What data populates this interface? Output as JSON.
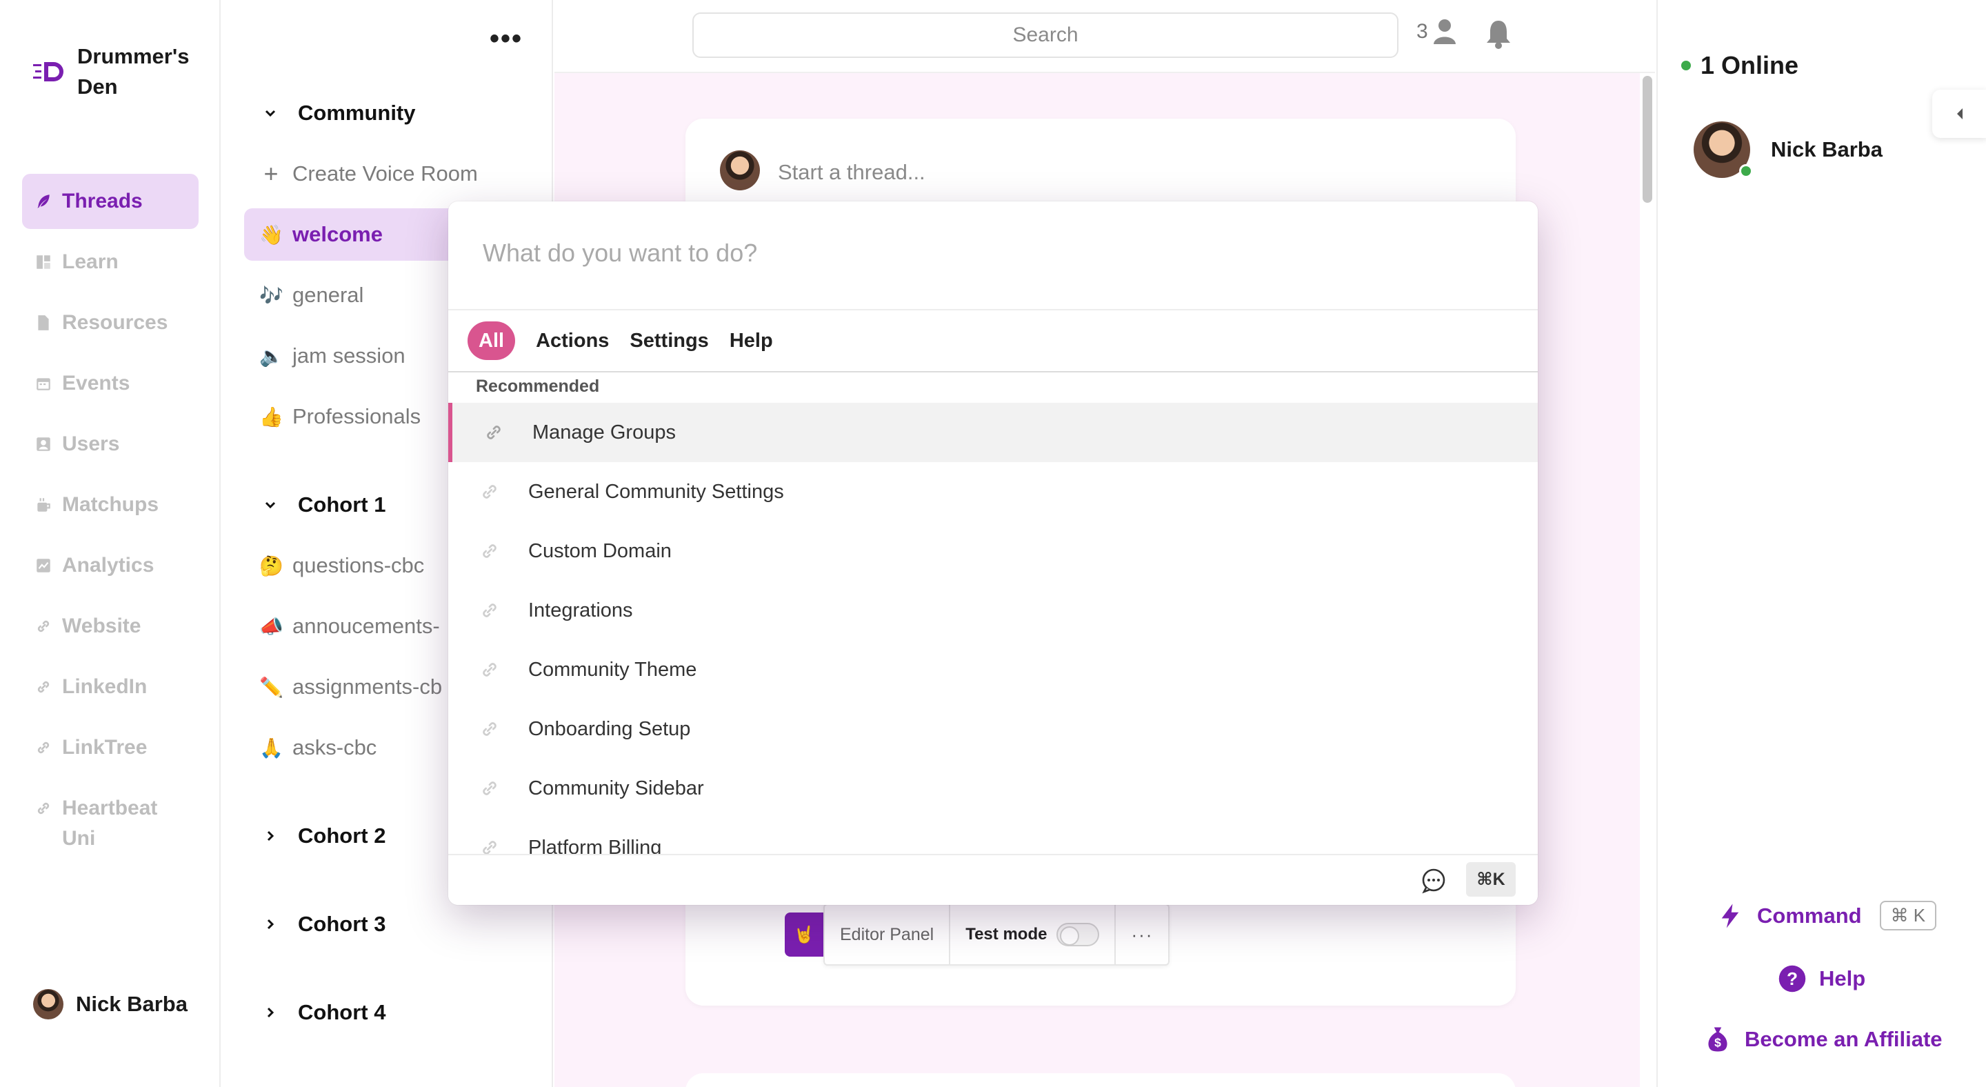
{
  "brand": {
    "name": "Drummer's Den",
    "accent": "#7a1fb0"
  },
  "leftnav": {
    "items": [
      {
        "label": "Threads",
        "icon": "feather-icon",
        "active": true
      },
      {
        "label": "Learn",
        "icon": "learn-icon"
      },
      {
        "label": "Resources",
        "icon": "document-icon"
      },
      {
        "label": "Events",
        "icon": "calendar-icon"
      },
      {
        "label": "Users",
        "icon": "users-icon"
      },
      {
        "label": "Matchups",
        "icon": "coffee-icon"
      },
      {
        "label": "Analytics",
        "icon": "chart-icon"
      },
      {
        "label": "Website",
        "icon": "link-icon"
      },
      {
        "label": "LinkedIn",
        "icon": "link-icon"
      },
      {
        "label": "LinkTree",
        "icon": "link-icon"
      },
      {
        "label": "Heartbeat Uni",
        "icon": "link-icon"
      }
    ],
    "user": "Nick Barba"
  },
  "channels": {
    "community": {
      "title": "Community",
      "create": "Create Voice Room",
      "items": [
        {
          "emoji": "👋",
          "label": "welcome",
          "active": true
        },
        {
          "emoji": "🎶",
          "label": "general"
        },
        {
          "emoji": "🔈",
          "label": "jam session"
        },
        {
          "emoji": "👍",
          "label": "Professionals"
        }
      ]
    },
    "cohort1": {
      "title": "Cohort 1",
      "items": [
        {
          "emoji": "🤔",
          "label": "questions-cbc"
        },
        {
          "emoji": "📣",
          "label": "annoucements-"
        },
        {
          "emoji": "✏️",
          "label": "assignments-cb"
        },
        {
          "emoji": "🙏",
          "label": "asks-cbc"
        }
      ]
    },
    "collapsed": [
      "Cohort 2",
      "Cohort 3",
      "Cohort 4"
    ]
  },
  "topbar": {
    "search_placeholder": "Search",
    "member_count": "3"
  },
  "thread": {
    "placeholder": "Start a thread..."
  },
  "editor": {
    "panel_label": "Editor Panel",
    "test_mode_label": "Test mode",
    "test_mode_on": false,
    "more": "···"
  },
  "palette": {
    "placeholder": "What do you want to do?",
    "tabs": [
      "All",
      "Actions",
      "Settings",
      "Help"
    ],
    "active_tab": "All",
    "section": "Recommended",
    "items": [
      "Manage Groups",
      "General Community Settings",
      "Custom Domain",
      "Integrations",
      "Community Theme",
      "Onboarding Setup",
      "Community Sidebar",
      "Platform Billing"
    ],
    "selected_index": 0,
    "shortcut": "⌘K",
    "highlight_color": "#d9558f"
  },
  "rightpanel": {
    "online_label": "1 Online",
    "member": "Nick Barba",
    "command_label": "Command",
    "command_shortcut": "⌘ K",
    "help_label": "Help",
    "affiliate_label": "Become an Affiliate"
  }
}
